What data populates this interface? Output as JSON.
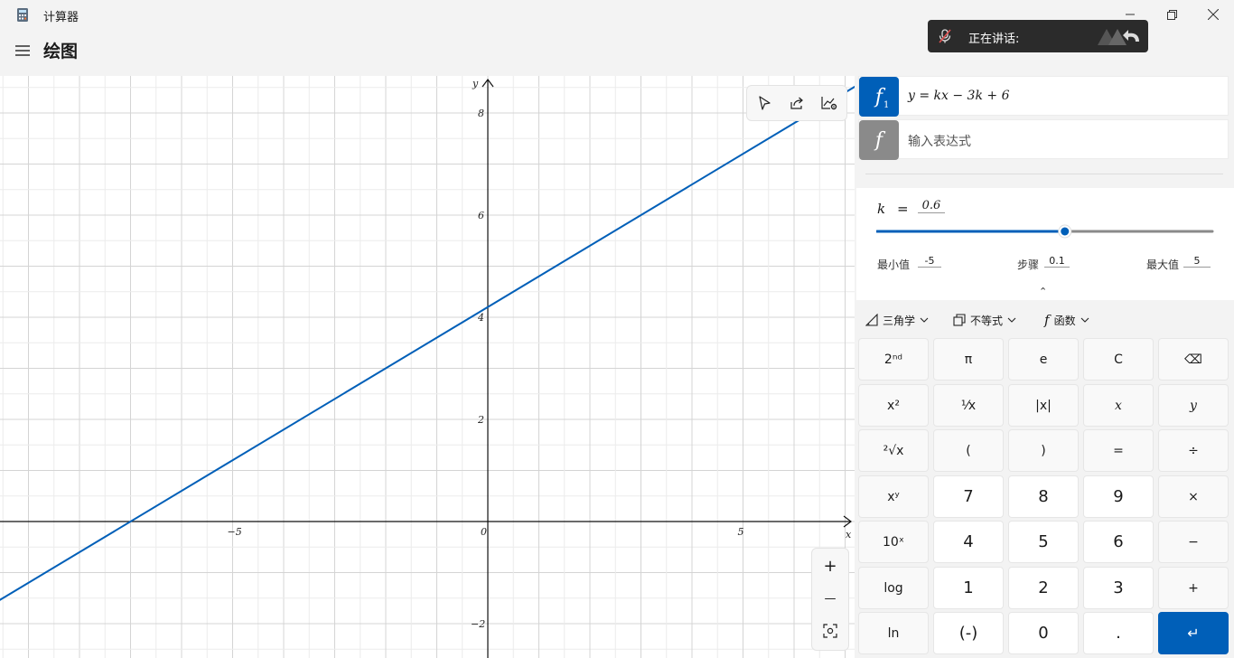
{
  "window": {
    "title": "计算器",
    "minimize_glyph": "—",
    "maximize_glyph": "❐",
    "close_glyph": "✕"
  },
  "header": {
    "page_title": "绘图"
  },
  "toast": {
    "label": "正在讲话:"
  },
  "graph": {
    "axis_labels": {
      "x": "x",
      "y": "y"
    },
    "x_ticks": [
      "−5",
      "0",
      "5"
    ],
    "y_ticks": [
      "8",
      "6",
      "4",
      "2",
      "−2"
    ],
    "line_color": "#005fb8",
    "zoom_in_glyph": "+",
    "zoom_out_glyph": "—"
  },
  "functions": [
    {
      "icon": "f",
      "subscript": "1",
      "expression": "y = kx − 3k + 6",
      "color": "#005fb8"
    },
    {
      "icon": "f",
      "placeholder": "输入表达式",
      "color": "#8a8a8a"
    }
  ],
  "variable": {
    "name": "k",
    "equals": "=",
    "value": "0.6",
    "slider_fraction": 0.56,
    "min_label": "最小值",
    "min_value": "-5",
    "step_label": "步骤",
    "step_value": "0.1",
    "max_label": "最大值",
    "max_value": "5"
  },
  "collapse_glyph": "⌃",
  "menus": [
    {
      "label": "三角学",
      "icon": "triangle-icon"
    },
    {
      "label": "不等式",
      "icon": "inequality-icon"
    },
    {
      "label": "函数",
      "icon": "function-icon"
    }
  ],
  "keypad": {
    "rows": [
      [
        "2ⁿᵈ",
        "π",
        "e",
        "C",
        "⌫"
      ],
      [
        "x²",
        "¹⁄x",
        "|x|",
        "x",
        "y"
      ],
      [
        "²√x",
        "(",
        ")",
        "=",
        "÷"
      ],
      [
        "xʸ",
        "7",
        "8",
        "9",
        "×"
      ],
      [
        "10ˣ",
        "4",
        "5",
        "6",
        "−"
      ],
      [
        "log",
        "1",
        "2",
        "3",
        "+"
      ],
      [
        "ln",
        "(-)",
        "0",
        ".",
        "↵"
      ]
    ]
  },
  "colors": {
    "accent": "#005fb8",
    "background": "#f3f3f3",
    "panel": "#ffffff"
  }
}
